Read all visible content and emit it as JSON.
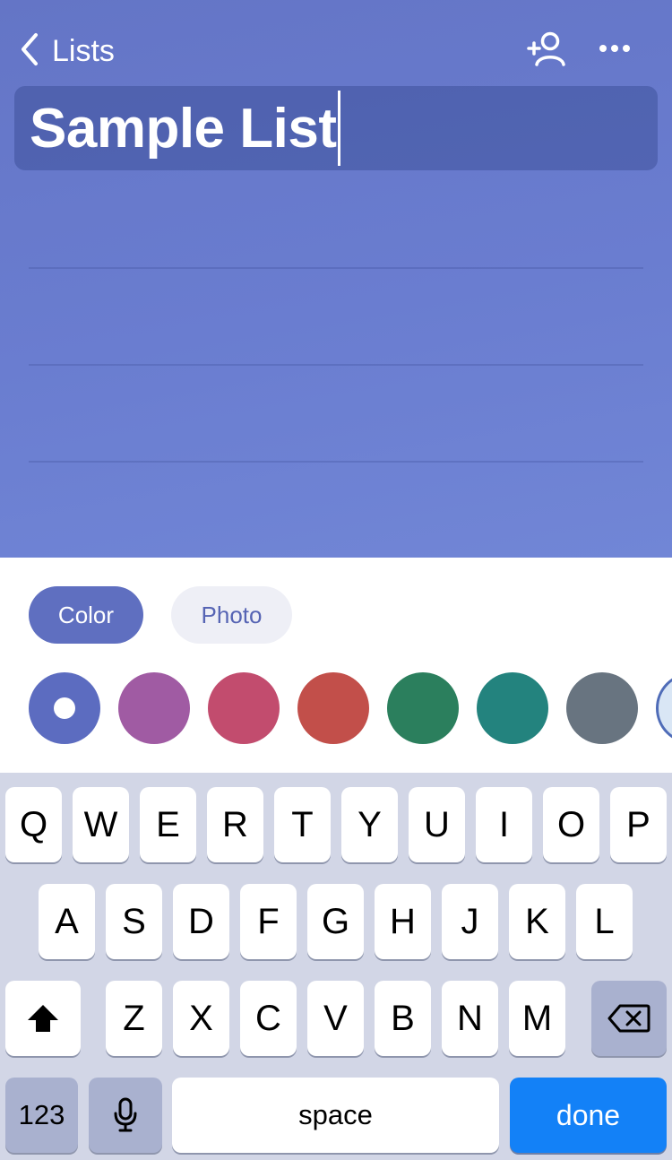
{
  "nav": {
    "back_label": "Lists",
    "back_icon": "chevron-left-icon",
    "share_icon": "add-person-icon",
    "more_icon": "ellipsis-icon"
  },
  "list": {
    "title": "Sample List"
  },
  "background_picker": {
    "tabs": [
      {
        "label": "Color",
        "selected": true
      },
      {
        "label": "Photo",
        "selected": false
      }
    ],
    "swatches": [
      {
        "color": "#5c6cc0",
        "selected": true
      },
      {
        "color": "#a05ba3",
        "selected": false
      },
      {
        "color": "#c24c6e",
        "selected": false
      },
      {
        "color": "#c24f4a",
        "selected": false
      },
      {
        "color": "#2b7f5d",
        "selected": false
      },
      {
        "color": "#23837e",
        "selected": false
      },
      {
        "color": "#687480",
        "selected": false
      },
      {
        "color": "#d9e6f5",
        "selected": false
      }
    ]
  },
  "keyboard": {
    "row1": [
      "Q",
      "W",
      "E",
      "R",
      "T",
      "Y",
      "U",
      "I",
      "O",
      "P"
    ],
    "row2": [
      "A",
      "S",
      "D",
      "F",
      "G",
      "H",
      "J",
      "K",
      "L"
    ],
    "row3": [
      "Z",
      "X",
      "C",
      "V",
      "B",
      "N",
      "M"
    ],
    "numbers_label": "123",
    "space_label": "space",
    "done_label": "done",
    "shift_icon": "shift-icon",
    "delete_icon": "backspace-icon",
    "mic_icon": "microphone-icon"
  },
  "colors": {
    "accent": "#1381f7",
    "theme": "#6475c6"
  }
}
